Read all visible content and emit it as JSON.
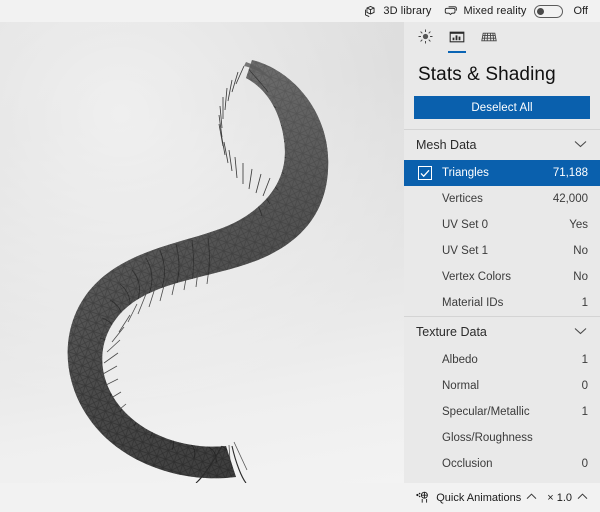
{
  "topbar": {
    "library": {
      "icon": "cube-library-icon",
      "label": "3D library"
    },
    "mixed_reality": {
      "icon": "mixed-reality-icon",
      "label": "Mixed reality",
      "state": "Off",
      "enabled": false
    }
  },
  "panel": {
    "tabs": [
      {
        "id": "lighting",
        "icon": "sun-lighting-icon",
        "active": false
      },
      {
        "id": "stats-shading",
        "icon": "stats-chart-icon",
        "active": true
      },
      {
        "id": "grid",
        "icon": "grid-floor-icon",
        "active": false
      }
    ],
    "title": "Stats & Shading",
    "deselect_label": "Deselect All",
    "accent_color": "#0a60ad",
    "sections": [
      {
        "id": "mesh-data",
        "label": "Mesh Data",
        "expanded": true,
        "chevron": "chevron-down-icon",
        "rows": [
          {
            "label": "Triangles",
            "value": "71,188",
            "selected": true,
            "checked": true
          },
          {
            "label": "Vertices",
            "value": "42,000",
            "selected": false,
            "checked": false
          },
          {
            "label": "UV Set 0",
            "value": "Yes",
            "selected": false,
            "checked": false
          },
          {
            "label": "UV Set 1",
            "value": "No",
            "selected": false,
            "checked": false
          },
          {
            "label": "Vertex Colors",
            "value": "No",
            "selected": false,
            "checked": false
          },
          {
            "label": "Material IDs",
            "value": "1",
            "selected": false,
            "checked": false
          }
        ]
      },
      {
        "id": "texture-data",
        "label": "Texture Data",
        "expanded": true,
        "chevron": "chevron-down-icon",
        "rows": [
          {
            "label": "Albedo",
            "value": "1",
            "selected": false,
            "checked": false
          },
          {
            "label": "Normal",
            "value": "0",
            "selected": false,
            "checked": false
          },
          {
            "label": "Specular/Metallic",
            "value": "1",
            "selected": false,
            "checked": false
          },
          {
            "label": "Gloss/Roughness",
            "value": "",
            "selected": false,
            "checked": false
          },
          {
            "label": "Occlusion",
            "value": "0",
            "selected": false,
            "checked": false
          }
        ]
      }
    ]
  },
  "bottombar": {
    "quick_animations": {
      "icon": "animation-figure-icon",
      "label": "Quick Animations",
      "chevron": "chevron-up-icon"
    },
    "speed": {
      "label": "× 1.0",
      "chevron": "chevron-up-icon"
    }
  },
  "viewport": {
    "model_name": "bristle-worm-wireframe-model",
    "background_top": "#dcdcdc",
    "background_bottom": "#f3f3f3"
  }
}
